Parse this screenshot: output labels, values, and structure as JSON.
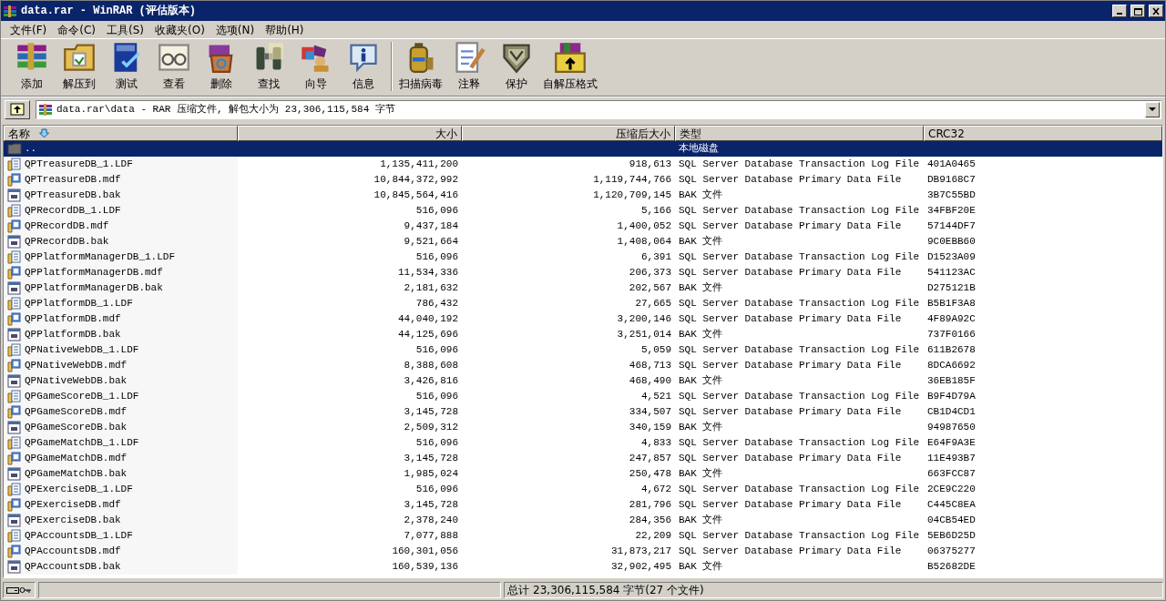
{
  "window": {
    "title": "data.rar - WinRAR (评估版本)"
  },
  "menu": [
    "文件(F)",
    "命令(C)",
    "工具(S)",
    "收藏夹(O)",
    "选项(N)",
    "帮助(H)"
  ],
  "toolbar": {
    "groups": [
      [
        "添加",
        "解压到",
        "测试",
        "查看",
        "删除",
        "查找",
        "向导",
        "信息"
      ],
      [
        "扫描病毒",
        "注释",
        "保护",
        "自解压格式"
      ]
    ]
  },
  "address": {
    "path": "data.rar\\data - RAR 压缩文件, 解包大小为 23,306,115,584 字节"
  },
  "table": {
    "columns": [
      {
        "label": "名称",
        "sorted": true
      },
      {
        "label": "大小",
        "sorted": false
      },
      {
        "label": "压缩后大小",
        "sorted": false
      },
      {
        "label": "类型",
        "sorted": false
      },
      {
        "label": "CRC32",
        "sorted": false
      }
    ],
    "rows": [
      {
        "kind": "parent",
        "name": "..",
        "size": "",
        "packed": "",
        "type": "本地磁盘",
        "crc": "",
        "selected": true
      },
      {
        "kind": "ldf",
        "name": "QPTreasureDB_1.LDF",
        "size": "1,135,411,200",
        "packed": "918,613",
        "type": "SQL Server Database Transaction Log File",
        "crc": "401A0465",
        "selected": false
      },
      {
        "kind": "mdf",
        "name": "QPTreasureDB.mdf",
        "size": "10,844,372,992",
        "packed": "1,119,744,766",
        "type": "SQL Server Database Primary Data File",
        "crc": "DB9168C7",
        "selected": false
      },
      {
        "kind": "bak",
        "name": "QPTreasureDB.bak",
        "size": "10,845,564,416",
        "packed": "1,120,709,145",
        "type": "BAK 文件",
        "crc": "3B7C55BD",
        "selected": false
      },
      {
        "kind": "ldf",
        "name": "QPRecordDB_1.LDF",
        "size": "516,096",
        "packed": "5,166",
        "type": "SQL Server Database Transaction Log File",
        "crc": "34FBF20E",
        "selected": false
      },
      {
        "kind": "mdf",
        "name": "QPRecordDB.mdf",
        "size": "9,437,184",
        "packed": "1,400,052",
        "type": "SQL Server Database Primary Data File",
        "crc": "57144DF7",
        "selected": false
      },
      {
        "kind": "bak",
        "name": "QPRecordDB.bak",
        "size": "9,521,664",
        "packed": "1,408,064",
        "type": "BAK 文件",
        "crc": "9C0EBB60",
        "selected": false
      },
      {
        "kind": "ldf",
        "name": "QPPlatformManagerDB_1.LDF",
        "size": "516,096",
        "packed": "6,391",
        "type": "SQL Server Database Transaction Log File",
        "crc": "D1523A09",
        "selected": false
      },
      {
        "kind": "mdf",
        "name": "QPPlatformManagerDB.mdf",
        "size": "11,534,336",
        "packed": "206,373",
        "type": "SQL Server Database Primary Data File",
        "crc": "541123AC",
        "selected": false
      },
      {
        "kind": "bak",
        "name": "QPPlatformManagerDB.bak",
        "size": "2,181,632",
        "packed": "202,567",
        "type": "BAK 文件",
        "crc": "D275121B",
        "selected": false
      },
      {
        "kind": "ldf",
        "name": "QPPlatformDB_1.LDF",
        "size": "786,432",
        "packed": "27,665",
        "type": "SQL Server Database Transaction Log File",
        "crc": "B5B1F3A8",
        "selected": false
      },
      {
        "kind": "mdf",
        "name": "QPPlatformDB.mdf",
        "size": "44,040,192",
        "packed": "3,200,146",
        "type": "SQL Server Database Primary Data File",
        "crc": "4F89A92C",
        "selected": false
      },
      {
        "kind": "bak",
        "name": "QPPlatformDB.bak",
        "size": "44,125,696",
        "packed": "3,251,014",
        "type": "BAK 文件",
        "crc": "737F0166",
        "selected": false
      },
      {
        "kind": "ldf",
        "name": "QPNativeWebDB_1.LDF",
        "size": "516,096",
        "packed": "5,059",
        "type": "SQL Server Database Transaction Log File",
        "crc": "611B2678",
        "selected": false
      },
      {
        "kind": "mdf",
        "name": "QPNativeWebDB.mdf",
        "size": "8,388,608",
        "packed": "468,713",
        "type": "SQL Server Database Primary Data File",
        "crc": "8DCA6692",
        "selected": false
      },
      {
        "kind": "bak",
        "name": "QPNativeWebDB.bak",
        "size": "3,426,816",
        "packed": "468,490",
        "type": "BAK 文件",
        "crc": "36EB185F",
        "selected": false
      },
      {
        "kind": "ldf",
        "name": "QPGameScoreDB_1.LDF",
        "size": "516,096",
        "packed": "4,521",
        "type": "SQL Server Database Transaction Log File",
        "crc": "B9F4D79A",
        "selected": false
      },
      {
        "kind": "mdf",
        "name": "QPGameScoreDB.mdf",
        "size": "3,145,728",
        "packed": "334,507",
        "type": "SQL Server Database Primary Data File",
        "crc": "CB1D4CD1",
        "selected": false
      },
      {
        "kind": "bak",
        "name": "QPGameScoreDB.bak",
        "size": "2,509,312",
        "packed": "340,159",
        "type": "BAK 文件",
        "crc": "94987650",
        "selected": false
      },
      {
        "kind": "ldf",
        "name": "QPGameMatchDB_1.LDF",
        "size": "516,096",
        "packed": "4,833",
        "type": "SQL Server Database Transaction Log File",
        "crc": "E64F9A3E",
        "selected": false
      },
      {
        "kind": "mdf",
        "name": "QPGameMatchDB.mdf",
        "size": "3,145,728",
        "packed": "247,857",
        "type": "SQL Server Database Primary Data File",
        "crc": "11E493B7",
        "selected": false
      },
      {
        "kind": "bak",
        "name": "QPGameMatchDB.bak",
        "size": "1,985,024",
        "packed": "250,478",
        "type": "BAK 文件",
        "crc": "663FCC87",
        "selected": false
      },
      {
        "kind": "ldf",
        "name": "QPExerciseDB_1.LDF",
        "size": "516,096",
        "packed": "4,672",
        "type": "SQL Server Database Transaction Log File",
        "crc": "2CE9C220",
        "selected": false
      },
      {
        "kind": "mdf",
        "name": "QPExerciseDB.mdf",
        "size": "3,145,728",
        "packed": "281,796",
        "type": "SQL Server Database Primary Data File",
        "crc": "C445C8EA",
        "selected": false
      },
      {
        "kind": "bak",
        "name": "QPExerciseDB.bak",
        "size": "2,378,240",
        "packed": "284,356",
        "type": "BAK 文件",
        "crc": "04CB54ED",
        "selected": false
      },
      {
        "kind": "ldf",
        "name": "QPAccountsDB_1.LDF",
        "size": "7,077,888",
        "packed": "22,209",
        "type": "SQL Server Database Transaction Log File",
        "crc": "5EB6D25D",
        "selected": false
      },
      {
        "kind": "mdf",
        "name": "QPAccountsDB.mdf",
        "size": "160,301,056",
        "packed": "31,873,217",
        "type": "SQL Server Database Primary Data File",
        "crc": "06375277",
        "selected": false
      },
      {
        "kind": "bak",
        "name": "QPAccountsDB.bak",
        "size": "160,539,136",
        "packed": "32,902,495",
        "type": "BAK 文件",
        "crc": "B52682DE",
        "selected": false
      }
    ]
  },
  "status_bar": {
    "total": "总计 23,306,115,584 字节(27 个文件)"
  }
}
